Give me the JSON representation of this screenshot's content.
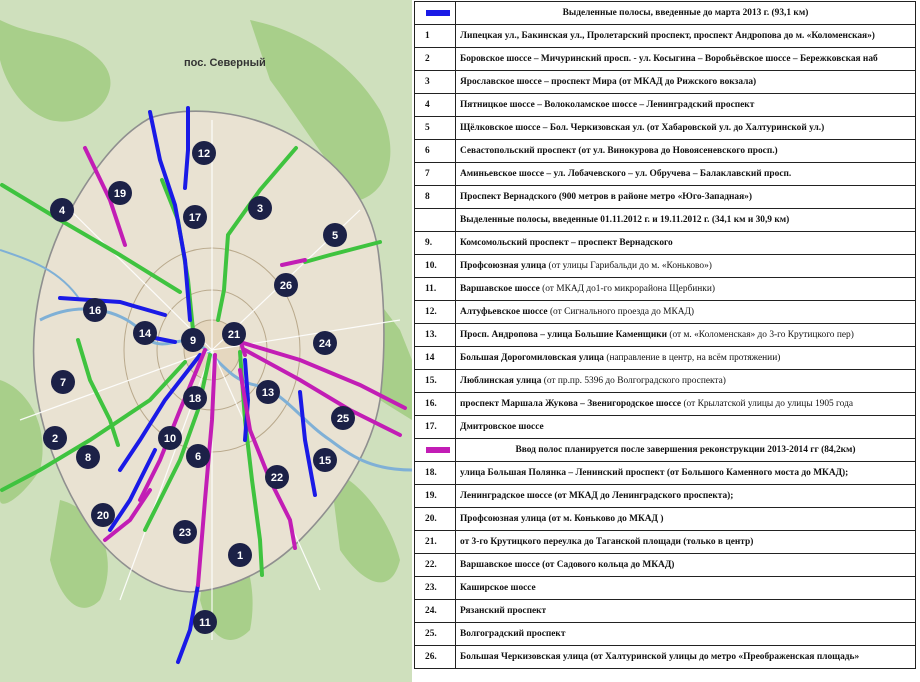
{
  "map": {
    "settlement_label": "пос. Северный",
    "colors": {
      "blue": "#1a1ae6",
      "green": "#3fc33f",
      "magenta": "#c21db5",
      "marker": "#1c2147"
    },
    "markers": [
      "1",
      "2",
      "3",
      "4",
      "5",
      "6",
      "7",
      "8",
      "9",
      "10",
      "11",
      "12",
      "13",
      "14",
      "15",
      "16",
      "17",
      "18",
      "19",
      "20",
      "21",
      "22",
      "23",
      "24",
      "25",
      "26"
    ]
  },
  "legend": {
    "section_blue": {
      "color": "#1a1ae6",
      "title": "Выделенные полосы, введенные до марта 2013 г.  (93,1 км)"
    },
    "section_green": {
      "title": "Выделенные полосы, введенные 01.11.2012 г.  и 19.11.2012 г. (34,1 км и 30,9 км)"
    },
    "section_magenta": {
      "color": "#c21db5",
      "title": "Ввод полос планируется после завершения реконструкции 2013-2014 гг (84,2км)"
    },
    "rows": [
      {
        "n": "1",
        "text": "Липецкая ул., Бакинская ул., Пролетарский проспект, проспект Андропова до м. «Коломенская»)"
      },
      {
        "n": "2",
        "text": "Боровское шоссе – Мичуринский просп. - ул. Косыгина – Воробьёвское шоссе – Бережковская наб"
      },
      {
        "n": "3",
        "text": "Ярославское шоссе – проспект Мира (от МКАД до Рижского вокзала)"
      },
      {
        "n": "4",
        "text": "Пятницкое шоссе – Волоколамское шоссе – Ленинградский проспект"
      },
      {
        "n": "5",
        "text": "Щёлковское шоссе – Бол. Черкизовская ул. (от Хабаровской ул. до Халтуринской ул.)"
      },
      {
        "n": "6",
        "text": "Севастопольский проспект (от ул. Винокурова до Новоясеневского просп.)"
      },
      {
        "n": "7",
        "text": "Аминьевское шоссе – ул. Лобачевского – ул. Обручева – Балаклавский просп."
      },
      {
        "n": "8",
        "text": "Проспект Вернадского (900 метров в районе метро «Юго-Западная»)"
      },
      {
        "n": "9.",
        "text": "Комсомольский проспект – проспект Вернадского"
      },
      {
        "n": "10.",
        "text": "Профсоюзная улица",
        "rest": " (от улицы Гарибальди до м. «Коньково»)"
      },
      {
        "n": "11.",
        "text": "Варшавское шоссе",
        "rest": " (от МКАД до1-го микрорайона  Щербинки)"
      },
      {
        "n": "12.",
        "text": "Алтуфьевское шоссе",
        "rest": " (от Сигнального проезда до МКАД)"
      },
      {
        "n": "13.",
        "text": "Просп. Андропова – улица Большие Каменщики",
        "rest": " (от м. «Коломенская» до 3-го Крутицкого пер)"
      },
      {
        "n": "14",
        "text": "Большая Дорогомиловская улица",
        "rest": " (направление в центр, на всём протяжении)"
      },
      {
        "n": "15.",
        "text": "Люблинская улица",
        "rest": " (от пр.пр. 5396 до Волгоградского проспекта)"
      },
      {
        "n": "16.",
        "text": "проспект Маршала Жукова – Звенигородское шоссе",
        "rest": " (от Крылатской улицы до улицы 1905 года"
      },
      {
        "n": "17.",
        "text": "Дмитровское шоссе"
      },
      {
        "n": "18.",
        "text": "улица Большая Полянка – Ленинский проспект (от Большого Каменного моста до МКАД);"
      },
      {
        "n": "19.",
        "text": "Ленинградское шоссе (от МКАД до Ленинградского проспекта);"
      },
      {
        "n": "20.",
        "text": "Профсоюзная улица (от м. Коньково до МКАД )"
      },
      {
        "n": "21.",
        "text": "от 3-го Крутицкого переулка до Таганской площади (только в центр)"
      },
      {
        "n": "22.",
        "text": "Варшавское  шоссе (от Садового кольца до МКАД)"
      },
      {
        "n": "23.",
        "text": "Каширское  шоссе"
      },
      {
        "n": "24.",
        "text": "Рязанский проспект"
      },
      {
        "n": "25.",
        "text": "Волгоградский проспект"
      },
      {
        "n": "26.",
        "text": "Большая Черкизовская улица (от Халтуринской улицы до метро «Преображенская площадь»"
      }
    ]
  }
}
